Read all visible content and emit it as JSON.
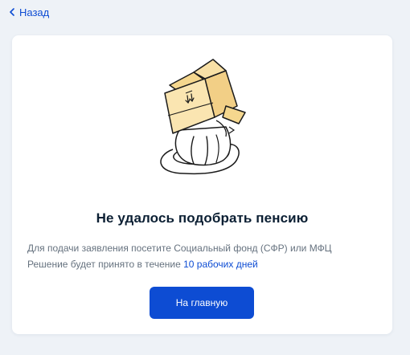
{
  "nav": {
    "back_label": "Назад"
  },
  "result": {
    "title": "Не удалось подобрать пенсию",
    "line1": "Для подачи заявления посетите Социальный фонд (СФР) или МФЦ",
    "line2_prefix": "Решение будет принято в течение ",
    "line2_highlight": "10 рабочих дней",
    "button_label": "На главную",
    "illustration_icon": "cat-in-box-icon"
  },
  "colors": {
    "accent": "#0d4cd3",
    "background": "#eef2f7",
    "title": "#0b1f33",
    "muted_text": "#66727f",
    "box_fill": "#fae5b1"
  }
}
